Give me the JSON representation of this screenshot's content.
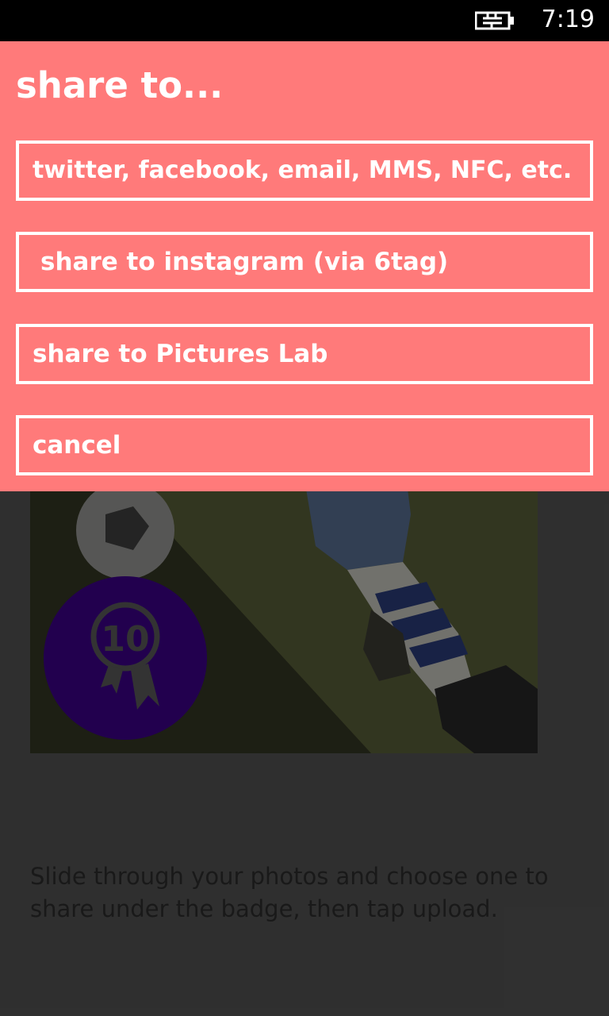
{
  "status_bar": {
    "time": "7:19",
    "battery_icon": "battery-charging-icon"
  },
  "share_dialog": {
    "title": "share to...",
    "options": [
      {
        "label": "twitter, facebook, email, MMS, NFC, etc."
      },
      {
        "label": " share to instagram (via 6tag)"
      },
      {
        "label": "share to Pictures Lab"
      },
      {
        "label": "cancel"
      }
    ],
    "background_color": "#ff7a7a"
  },
  "background": {
    "badge": {
      "number": "10",
      "icon": "award-ribbon-icon",
      "color": "#2a0060"
    },
    "instructions": "Slide through your photos and choose one to share under the badge, then tap upload."
  }
}
